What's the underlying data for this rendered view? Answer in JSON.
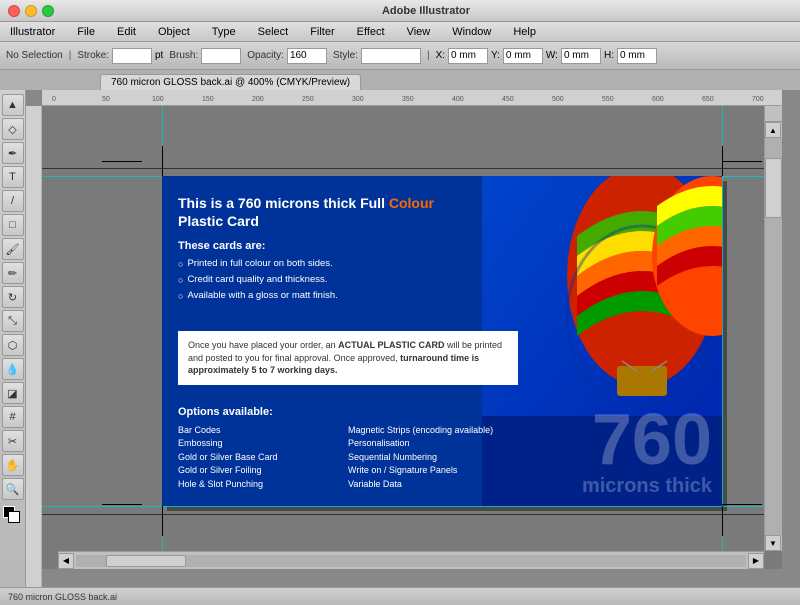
{
  "app": {
    "title": "Adobe Illustrator",
    "file_title": "760 micron GLOSS back.ai @ 400% (CMYK/Preview)",
    "traffic_lights": [
      "close",
      "minimize",
      "maximize"
    ]
  },
  "menu": {
    "items": [
      "Illustrator",
      "File",
      "Edit",
      "Object",
      "Type",
      "Select",
      "Filter",
      "Effect",
      "View",
      "Window",
      "Help"
    ]
  },
  "toolbar": {
    "labels": [
      "No Selection",
      "Stroke:",
      "pt",
      "Brush:",
      "Opacity:",
      "160",
      "Style:"
    ],
    "inputs": {
      "selection": "No Selection",
      "stroke": "",
      "brush": "",
      "opacity": "160",
      "x": "0 mm",
      "y": "0 mm",
      "w": "0 mm",
      "h": "0 mm"
    }
  },
  "doc_tab": {
    "label": "760 micron GLOSS back.ai @ 400% (CMYK/Preview)"
  },
  "card": {
    "title_part1": "This is a 760 microns thick Full ",
    "title_colour": "Colour",
    "title_part2": " Plastic Card",
    "these_cards_label": "These cards are:",
    "bullet_items": [
      "Printed in full colour on both sides.",
      "Credit card quality and thickness.",
      "Available with a gloss or matt finish."
    ],
    "notice_text_part1": "Once you have placed your order, an ",
    "notice_bold": "ACTUAL PLASTIC CARD",
    "notice_text_part2": " will be printed and posted to you for final approval. Once approved, ",
    "notice_bold2": "turnaround time is approximately 5 to 7 working days.",
    "options_label": "Options available:",
    "options_col1": [
      "Bar Codes",
      "Embossing",
      "Gold or Silver Base Card",
      "Gold or Silver Foiling",
      "Hole & Slot Punching"
    ],
    "options_col2": [
      "Magnetic Strips (encoding available)",
      "Personalisation",
      "Sequential Numbering",
      "Write on / Signature Panels",
      "Variable Data"
    ],
    "large_number": "760",
    "large_subtitle": "microns thick"
  },
  "status_bar": {
    "text": "760 micron GLOSS back.ai"
  },
  "tools": [
    "arrow",
    "pen",
    "text",
    "shape",
    "selection",
    "zoom",
    "eyedropper",
    "paint",
    "scissors",
    "rotate",
    "scale",
    "blend",
    "gradient",
    "mesh",
    "slice",
    "eraser",
    "hand",
    "zoom-tool"
  ]
}
